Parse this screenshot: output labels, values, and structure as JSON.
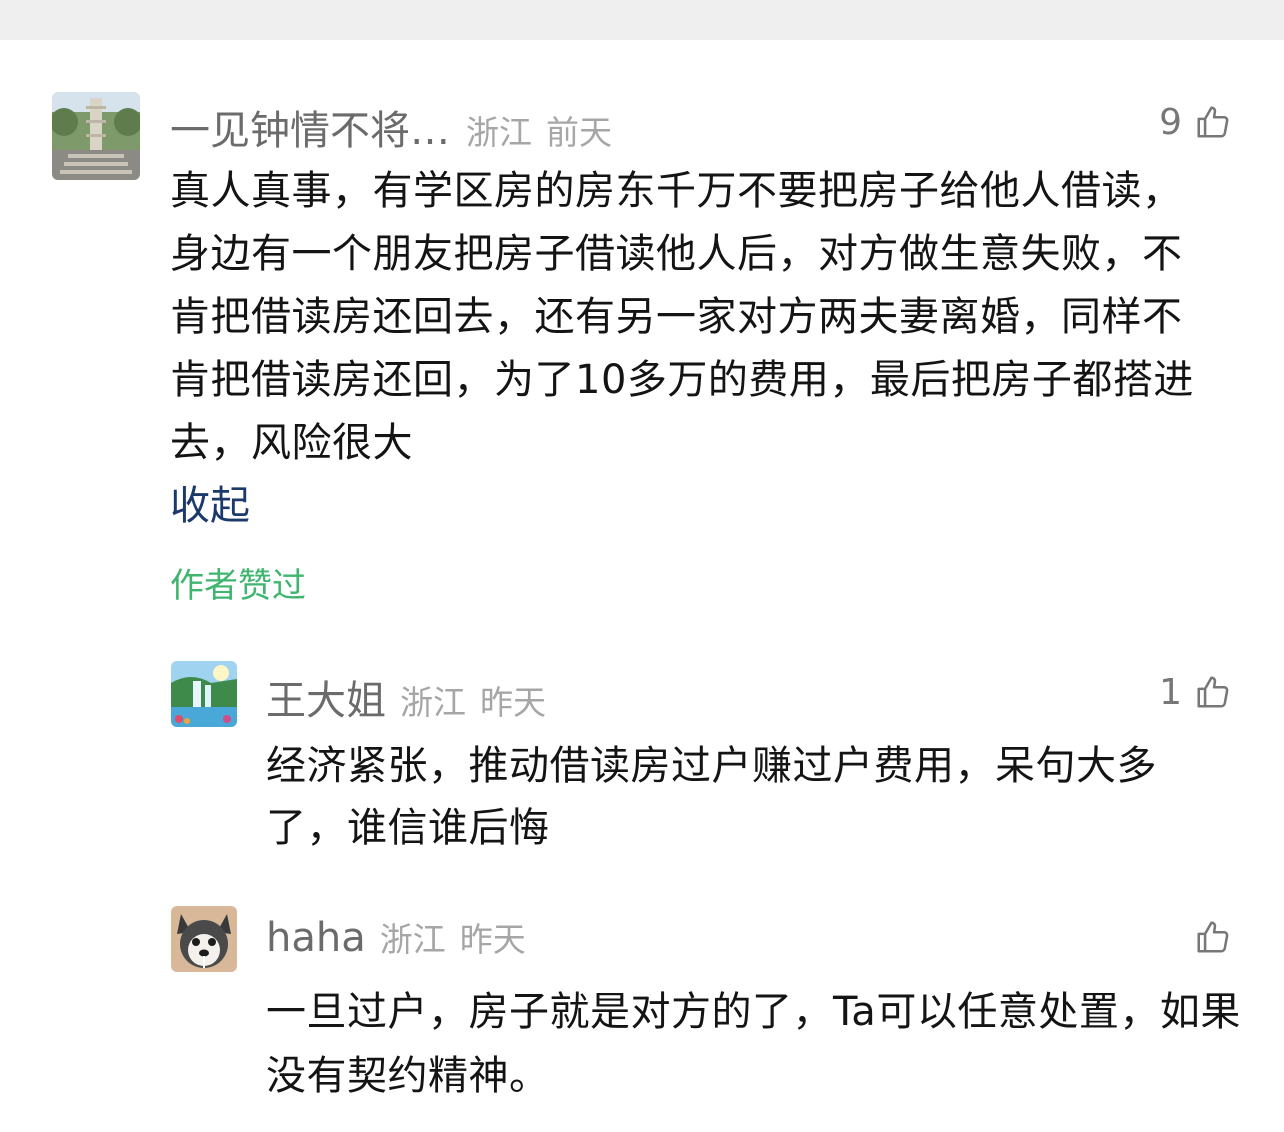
{
  "comments": [
    {
      "username": "一见钟情不将…",
      "location": "浙江",
      "time": "前天",
      "likes": "9",
      "text": "真人真事，有学区房的房东千万不要把房子给他人借读，身边有一个朋友把房子借读他人后，对方做生意失败，不肯把借读房还回去，还有另一家对方两夫妻离婚，同样不肯把借读房还回，为了10多万的费用，最后把房子都搭进去，风险很大",
      "collapse_label": "收起",
      "author_liked": "作者赞过"
    }
  ],
  "replies": [
    {
      "username": "王大姐",
      "location": "浙江",
      "time": "昨天",
      "likes": "1",
      "text": "经济紧张，推动借读房过户赚过户费用，呆句大多了，谁信谁后悔"
    },
    {
      "username": "haha",
      "location": "浙江",
      "time": "昨天",
      "likes": "",
      "text": "一旦过户，房子就是对方的了，Ta可以任意处置，如果没有契约精神。"
    }
  ]
}
